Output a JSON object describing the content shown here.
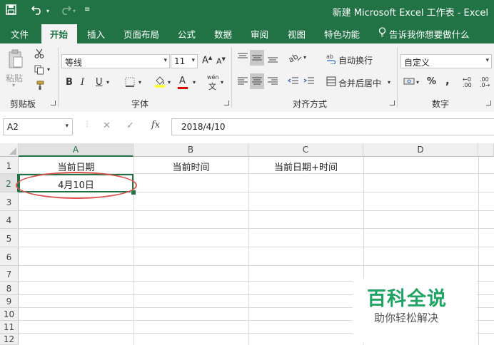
{
  "title_bar": {
    "title": "新建 Microsoft Excel 工作表 - Excel",
    "quick_access": [
      "save-icon",
      "undo-icon",
      "redo-icon",
      "customize-icon"
    ]
  },
  "tabs": [
    {
      "label": "文件",
      "active": false
    },
    {
      "label": "开始",
      "active": true
    },
    {
      "label": "插入",
      "active": false
    },
    {
      "label": "页面布局",
      "active": false
    },
    {
      "label": "公式",
      "active": false
    },
    {
      "label": "数据",
      "active": false
    },
    {
      "label": "审阅",
      "active": false
    },
    {
      "label": "视图",
      "active": false
    },
    {
      "label": "特色功能",
      "active": false
    }
  ],
  "tell_me": "告诉我你想要做什么",
  "ribbon": {
    "clipboard": {
      "paste_label": "粘贴",
      "group_label": "剪贴板"
    },
    "font": {
      "font_name": "等线",
      "font_size": "11",
      "grow": "A",
      "shrink": "A",
      "bold": "B",
      "italic": "I",
      "underline": "U",
      "font_color": "A",
      "phonetic": "wén",
      "group_label": "字体"
    },
    "alignment": {
      "wrap_text": "自动换行",
      "merge_center": "合并后居中",
      "group_label": "对齐方式"
    },
    "number": {
      "format": "自定义",
      "percent": "%",
      "comma": ",",
      "inc_decimal": ".00",
      "dec_decimal": ".0",
      "group_label": "数字"
    }
  },
  "formula_bar": {
    "name_box": "A2",
    "cancel": "✕",
    "enter": "✓",
    "fx": "fx",
    "value": "2018/4/10"
  },
  "sheet": {
    "columns": [
      "A",
      "B",
      "C",
      "D"
    ],
    "rows": [
      "1",
      "2",
      "3",
      "4",
      "5",
      "6",
      "7",
      "8",
      "9",
      "10",
      "11",
      "12"
    ],
    "cells": {
      "A1": "当前日期",
      "B1": "当前时间",
      "C1": "当前日期+时间",
      "A2": "4月10日"
    },
    "selected": "A2"
  },
  "watermark": {
    "title": "百科全说",
    "subtitle": "助你轻松解决"
  },
  "colors": {
    "excel_green": "#217346",
    "annotation_red": "#d9534f",
    "watermark_green": "#1fa463"
  }
}
